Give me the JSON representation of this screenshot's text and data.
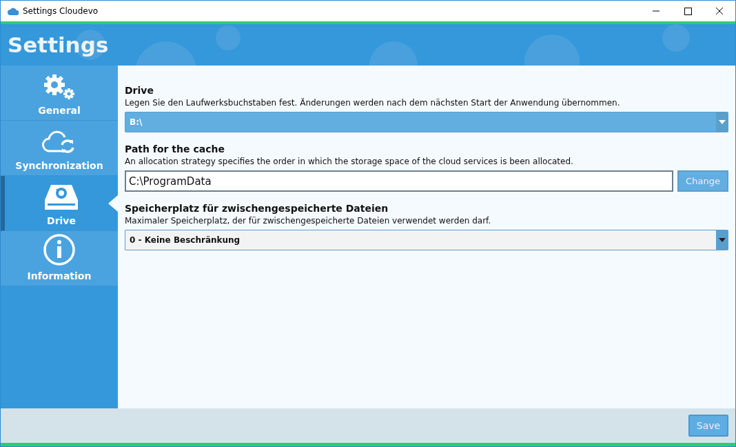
{
  "window": {
    "title": "Settings Cloudevo"
  },
  "header": {
    "title": "Settings"
  },
  "sidebar": {
    "items": [
      {
        "label": "General",
        "selected": false
      },
      {
        "label": "Synchronization",
        "selected": false
      },
      {
        "label": "Drive",
        "selected": true
      },
      {
        "label": "Information",
        "selected": false
      }
    ]
  },
  "sections": [
    {
      "kind": "dropdown",
      "heading": "Drive",
      "description": "Legen Sie den Laufwerksbuchstaben fest. Änderungen werden nach dem nächsten Start der Anwendung übernommen.",
      "value": "B:\\",
      "highlighted": true
    },
    {
      "kind": "path",
      "heading": "Path for the cache",
      "description": "An allocation strategy specifies the order in which the storage space of the cloud services is been allocated.",
      "value": "C:\\ProgramData",
      "button": "Change"
    },
    {
      "kind": "dropdown",
      "heading": "Speicherplatz für zwischengespeicherte Dateien",
      "description": "Maximaler Speicherplatz, der für zwischengespeicherte Dateien verwendet werden darf.",
      "value": "0 - Keine Beschränkung",
      "highlighted": false
    }
  ],
  "footer": {
    "button": "Save"
  }
}
